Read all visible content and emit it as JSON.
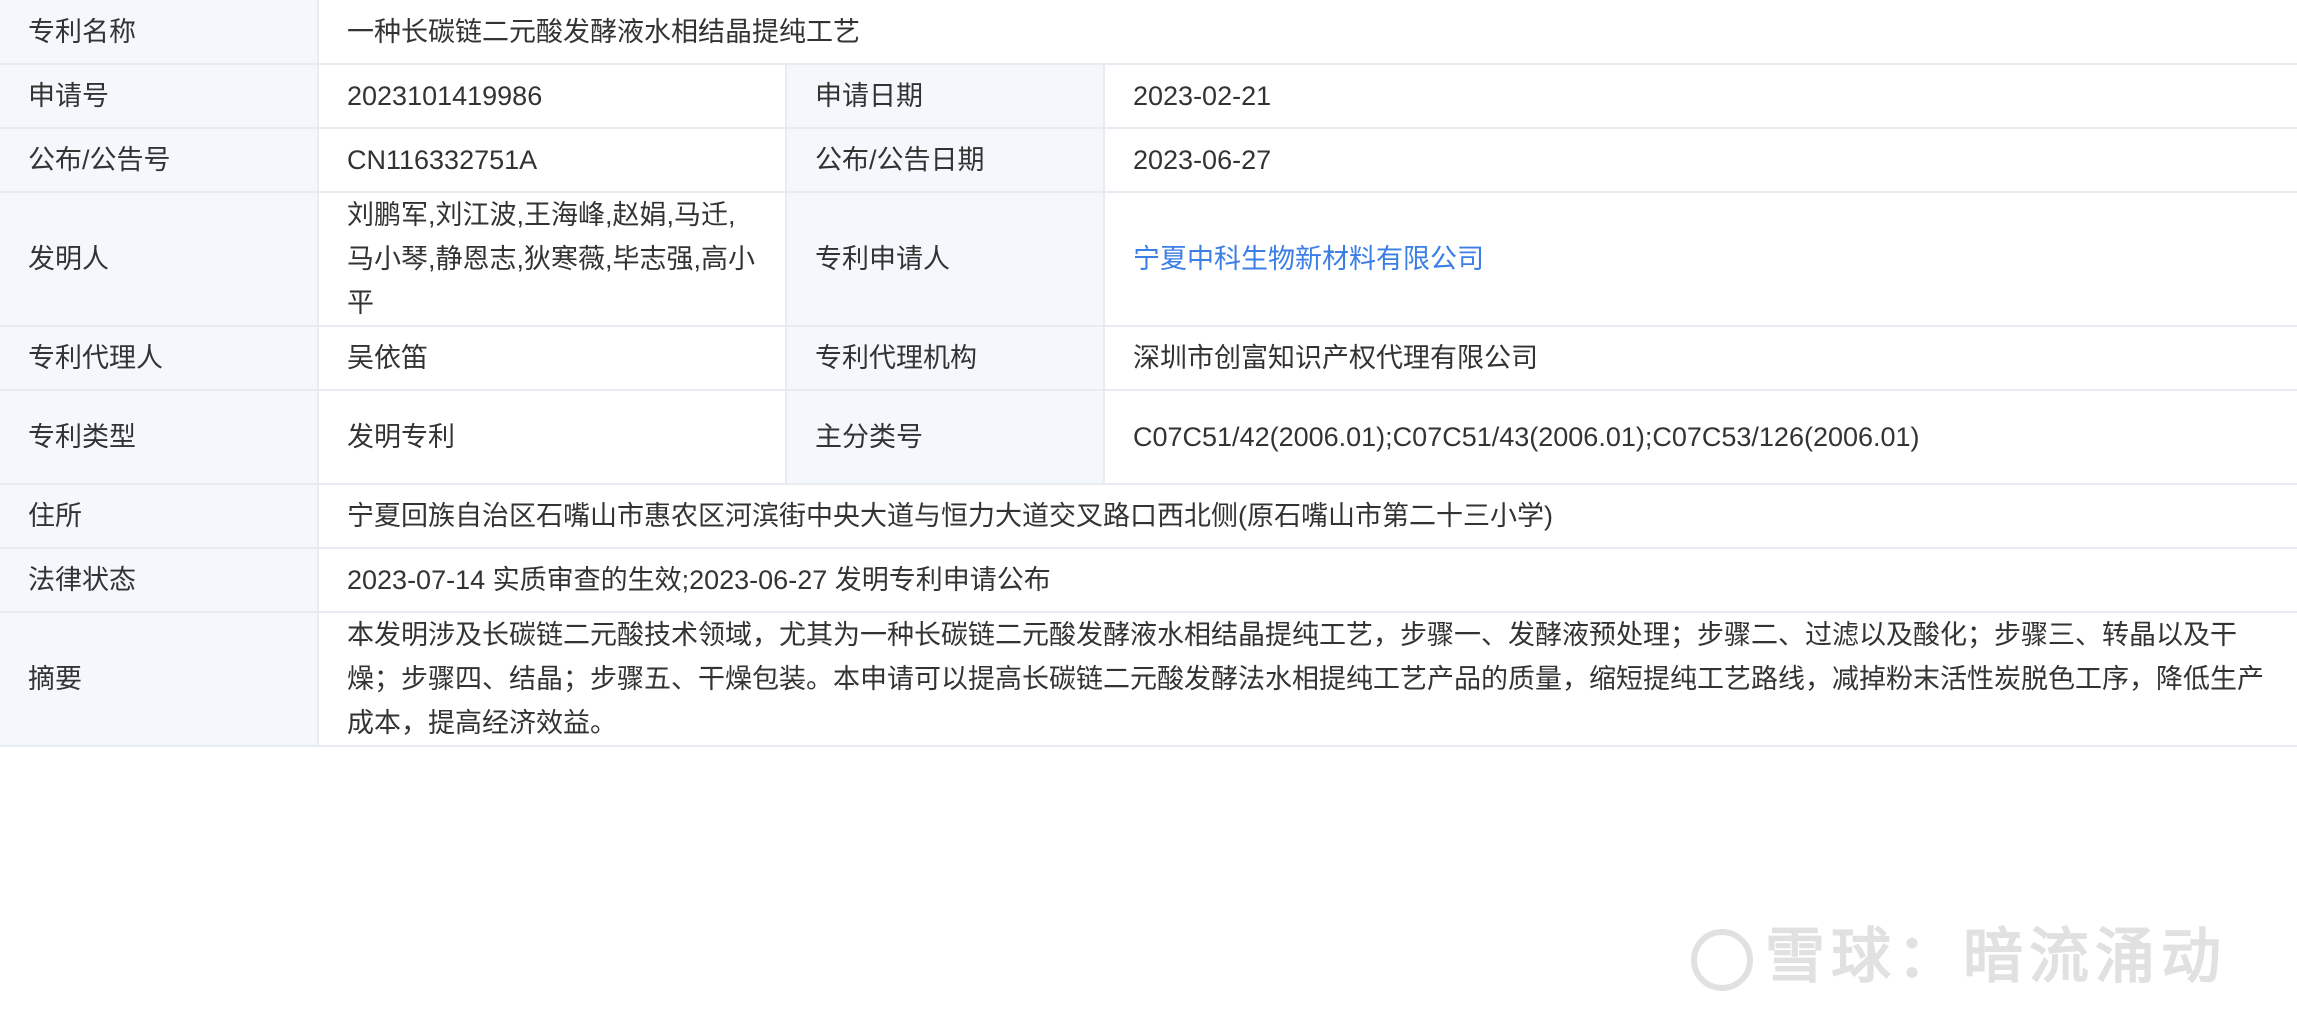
{
  "rows": {
    "name": {
      "label": "专利名称",
      "value": "一种长碳链二元酸发酵液水相结晶提纯工艺"
    },
    "app_no": {
      "label": "申请号",
      "value": "2023101419986"
    },
    "app_date": {
      "label": "申请日期",
      "value": "2023-02-21"
    },
    "pub_no": {
      "label": "公布/公告号",
      "value": "CN116332751A"
    },
    "pub_date": {
      "label": "公布/公告日期",
      "value": "2023-06-27"
    },
    "inventors": {
      "label": "发明人",
      "value": "刘鹏军,刘江波,王海峰,赵娟,马迁,马小琴,静恩志,狄寒薇,毕志强,高小平"
    },
    "applicant": {
      "label": "专利申请人",
      "value": "宁夏中科生物新材料有限公司"
    },
    "agent": {
      "label": "专利代理人",
      "value": "吴依笛"
    },
    "agency": {
      "label": "专利代理机构",
      "value": "深圳市创富知识产权代理有限公司"
    },
    "type": {
      "label": "专利类型",
      "value": "发明专利"
    },
    "main_class": {
      "label": "主分类号",
      "value": "C07C51/42(2006.01);C07C51/43(2006.01);C07C53/126(2006.01)"
    },
    "address": {
      "label": "住所",
      "value": "宁夏回族自治区石嘴山市惠农区河滨街中央大道与恒力大道交叉路口西北侧(原石嘴山市第二十三小学)"
    },
    "legal_status": {
      "label": "法律状态",
      "value": "2023-07-14 实质审查的生效;2023-06-27 发明专利申请公布"
    },
    "abstract": {
      "label": "摘要",
      "value": "本发明涉及长碳链二元酸技术领域，尤其为一种长碳链二元酸发酵液水相结晶提纯工艺，步骤一、发酵液预处理；步骤二、过滤以及酸化；步骤三、转晶以及干燥；步骤四、结晶；步骤五、干燥包装。本申请可以提高长碳链二元酸发酵法水相提纯工艺产品的质量，缩短提纯工艺路线，减掉粉末活性炭脱色工序，降低生产成本，提高经济效益。"
    }
  },
  "watermark": {
    "text": "雪球：暗流涌动"
  },
  "colors": {
    "label_bg": "#f4f8fd",
    "border": "#e8ecf2",
    "link": "#3a7ee6",
    "text": "#333333"
  }
}
